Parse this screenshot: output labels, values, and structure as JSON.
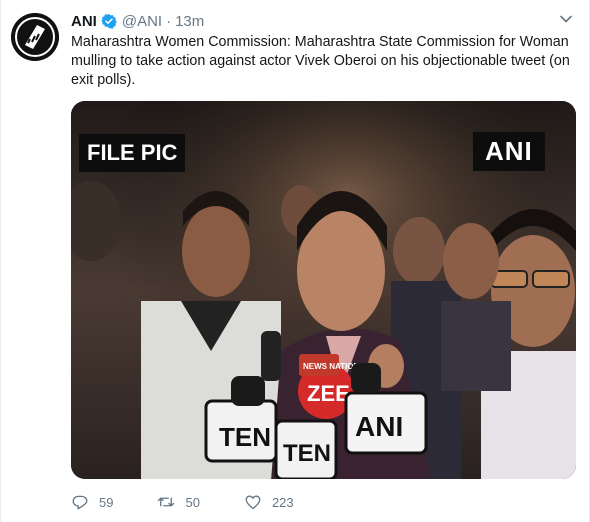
{
  "tweet": {
    "author_name": "ANI",
    "handle": "@ANI",
    "separator": "·",
    "time": "13m",
    "text": "Maharashtra Women Commission: Maharashtra State Commission for Woman mulling to take action against actor Vivek Oberoi on his objectionable tweet (on exit polls).",
    "media": {
      "overlay_left": "FILE PIC",
      "overlay_right": "ANI",
      "mic_labels": [
        "TEN",
        "TEN",
        "ZEE",
        "ANI",
        "NEWS NATION"
      ]
    },
    "actions": {
      "replies": "59",
      "retweets": "50",
      "likes": "223"
    },
    "icons": {
      "avatar": "ani-logo",
      "verified": "verified-badge-icon",
      "menu": "chevron-down-icon",
      "reply": "reply-icon",
      "retweet": "retweet-icon",
      "like": "heart-icon"
    },
    "colors": {
      "accent": "#1da1f2",
      "muted": "#657786",
      "text": "#14171a"
    }
  }
}
